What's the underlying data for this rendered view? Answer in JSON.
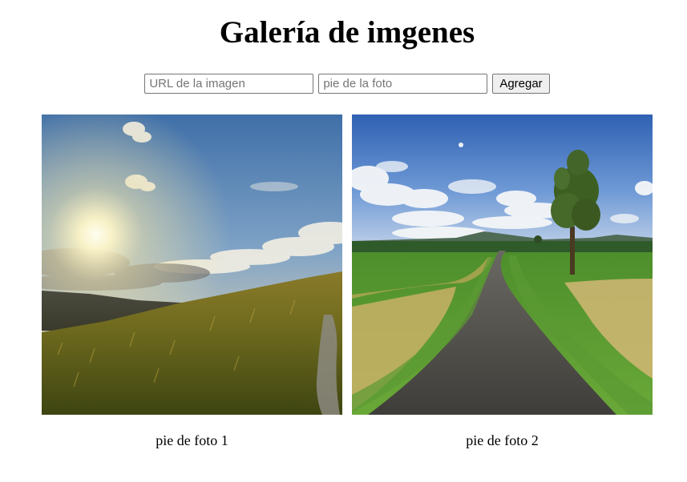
{
  "page": {
    "title": "Galería de imgenes"
  },
  "form": {
    "url_placeholder": "URL de la imagen",
    "caption_placeholder": "pie de la foto",
    "add_button_label": "Agregar"
  },
  "gallery": {
    "items": [
      {
        "caption": "pie de foto 1",
        "image": "sunset-meadow-photo"
      },
      {
        "caption": "pie de foto 2",
        "image": "country-road-photo"
      }
    ]
  }
}
